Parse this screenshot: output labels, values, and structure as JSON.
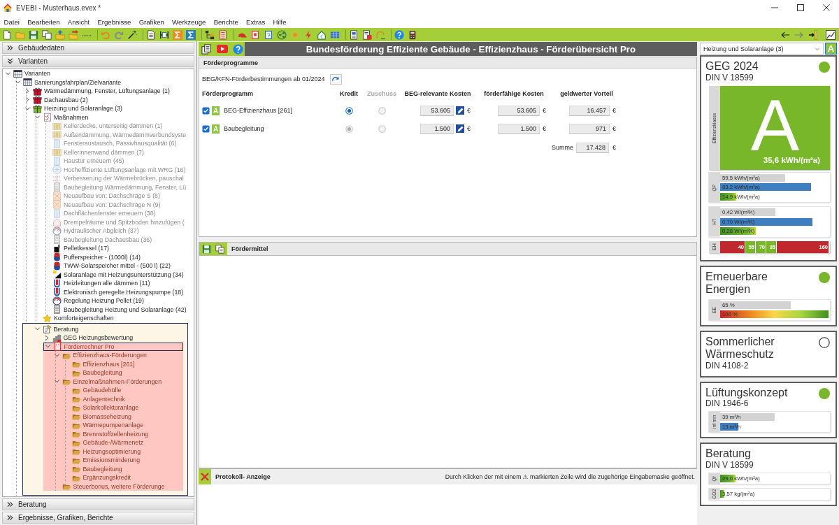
{
  "window": {
    "title": "EVEBI - Musterhaus.evex *"
  },
  "menu": [
    "Datei",
    "Bearbeiten",
    "Ansicht",
    "Ergebnisse",
    "Grafiken",
    "Werkzeuge",
    "Berichte",
    "Extras",
    "Hilfe"
  ],
  "sidebar": {
    "sections": [
      {
        "label": "Gebäudedaten",
        "expanded": false
      },
      {
        "label": "Varianten",
        "expanded": true,
        "tree": [
          {
            "label": "Varianten",
            "kind": "table",
            "expanded": true,
            "selected": false,
            "children": [
              {
                "label": "Sanierungsfahrplan/Zielvariante",
                "kind": "table",
                "expanded": true,
                "selected": false,
                "children": [
                  {
                    "label": "Wärmedämmung, Fenster, Lüftungsanlage (1)",
                    "kind": "variant",
                    "color": "#c8102e",
                    "expanded": false,
                    "selected": false
                  },
                  {
                    "label": "Dachausbau (2)",
                    "kind": "variant",
                    "color": "#c8102e",
                    "expanded": false,
                    "selected": false
                  },
                  {
                    "label": "Heizung und Solaranlage (3)",
                    "kind": "variant",
                    "color": "#7ab829",
                    "expanded": true,
                    "selected": false,
                    "children": [
                      {
                        "label": "Maßnahmen",
                        "kind": "checklist",
                        "expanded": true,
                        "selected": false,
                        "children": [
                          {
                            "label": "Kellerdecke, unterseitig dämmen (1)",
                            "kind": "insulation",
                            "disabled": true,
                            "selected": false
                          },
                          {
                            "label": "Außendämmung, Wärmedämmverbundsyste",
                            "kind": "insulation",
                            "disabled": true,
                            "selected": false
                          },
                          {
                            "label": "Fensteraustausch, Passivhausqualität (6)",
                            "kind": "pane",
                            "disabled": true,
                            "selected": false
                          },
                          {
                            "label": "Kellerinnenwand dämmen (7)",
                            "kind": "insulation",
                            "disabled": true,
                            "selected": false
                          },
                          {
                            "label": "Haustür erneuern (45)",
                            "kind": "pane",
                            "disabled": true,
                            "selected": false
                          },
                          {
                            "label": "Hocheffiziente Lüftungsanlage mit WRG (16)",
                            "kind": "fan",
                            "disabled": true,
                            "selected": false
                          },
                          {
                            "label": "Verbesserung der Wärmebrücken, pauschal",
                            "kind": "bridge",
                            "disabled": true,
                            "selected": false
                          },
                          {
                            "label": "Baubegleitung Wärmedämmung, Fenster, Lü",
                            "kind": "document",
                            "disabled": true,
                            "selected": false
                          },
                          {
                            "label": "Neuaufbau von: Dachschräge S (8)",
                            "kind": "roof",
                            "disabled": true,
                            "selected": false
                          },
                          {
                            "label": "Neuaufbau von: Dachschräge N (9)",
                            "kind": "roof",
                            "disabled": true,
                            "selected": false
                          },
                          {
                            "label": "Dachflächenfenster erneuern (38)",
                            "kind": "pane",
                            "disabled": true,
                            "selected": false
                          },
                          {
                            "label": "Drempelräume und Spitzboden hinzufügen (",
                            "kind": "house",
                            "disabled": true,
                            "selected": false
                          },
                          {
                            "label": "Hydraulischer Abgleich (37)",
                            "kind": "gauge",
                            "disabled": true,
                            "selected": false
                          },
                          {
                            "label": "Baubegleitung Dachausbau (36)",
                            "kind": "document",
                            "disabled": true,
                            "selected": false
                          },
                          {
                            "label": "Pelletkessel (17)",
                            "kind": "boiler",
                            "disabled": false,
                            "selected": false
                          },
                          {
                            "label": "Pufferspeicher - (1000l) (14)",
                            "kind": "tank",
                            "disabled": false,
                            "selected": false
                          },
                          {
                            "label": "TWW-Solarspeicher mittel - (500 l) (22)",
                            "kind": "tank",
                            "disabled": false,
                            "selected": false
                          },
                          {
                            "label": "Solaranlage mit Heizungsunterstützung (34)",
                            "kind": "solar",
                            "disabled": false,
                            "selected": false
                          },
                          {
                            "label": "Heizleitungen alle dämmen (11)",
                            "kind": "pipe",
                            "disabled": false,
                            "selected": false
                          },
                          {
                            "label": "Elektronisch geregelte Heizungspumpe (18)",
                            "kind": "pipe",
                            "disabled": false,
                            "selected": false
                          },
                          {
                            "label": "Regelung Heizung Pellet (19)",
                            "kind": "gauge",
                            "disabled": false,
                            "selected": false
                          },
                          {
                            "label": "Baubegleitung Heizung und Solaranlage (42)",
                            "kind": "document",
                            "disabled": false,
                            "selected": false
                          }
                        ]
                      },
                      {
                        "label": "Komforteigenschaften",
                        "kind": "star",
                        "selected": false
                      },
                      {
                        "label": "Beratung",
                        "kind": "consulting",
                        "expanded": true,
                        "selected": false,
                        "children": [
                          {
                            "label": "GEG Heizungsbewertung",
                            "kind": "assessment",
                            "expanded": false,
                            "selected": false
                          },
                          {
                            "label": "Förderrechner Pro",
                            "kind": "calculator",
                            "expanded": true,
                            "selected": true,
                            "children": [
                              {
                                "label": "Effizienzhaus-Förderungen",
                                "kind": "folder",
                                "expanded": true,
                                "selected": false,
                                "children": [
                                  {
                                    "label": "Effizienzhaus [261]",
                                    "kind": "folder",
                                    "selected": false
                                  },
                                  {
                                    "label": "Baubegleitung",
                                    "kind": "folder",
                                    "selected": false
                                  }
                                ]
                              },
                              {
                                "label": "Einzelmaßnahmen-Förderungen",
                                "kind": "folder",
                                "expanded": true,
                                "selected": false,
                                "children": [
                                  {
                                    "label": "Gebäudehülle",
                                    "kind": "folder",
                                    "selected": false
                                  },
                                  {
                                    "label": "Anlagentechnik",
                                    "kind": "folder",
                                    "selected": false
                                  },
                                  {
                                    "label": "Solarkollektoranlage",
                                    "kind": "folder",
                                    "selected": false
                                  },
                                  {
                                    "label": "Biomasseheizung",
                                    "kind": "folder",
                                    "selected": false
                                  },
                                  {
                                    "label": "Wärmepumpenanlage",
                                    "kind": "folder",
                                    "selected": false
                                  },
                                  {
                                    "label": "Brennstoffzellenheizung",
                                    "kind": "folder",
                                    "selected": false
                                  },
                                  {
                                    "label": "Gebäude-/Wärmenetz",
                                    "kind": "folder",
                                    "selected": false
                                  },
                                  {
                                    "label": "Heizungsoptimierung",
                                    "kind": "folder",
                                    "selected": false
                                  },
                                  {
                                    "label": "Emissionsminderung",
                                    "kind": "folder",
                                    "selected": false
                                  },
                                  {
                                    "label": "Baubegleitung",
                                    "kind": "folder",
                                    "selected": false
                                  },
                                  {
                                    "label": "Ergänzungskredit",
                                    "kind": "folder",
                                    "selected": false
                                  }
                                ]
                              },
                              {
                                "label": "Steuerbonus, weitere Förderunge",
                                "kind": "folder",
                                "selected": false
                              }
                            ]
                          }
                        ]
                      }
                    ]
                  }
                ]
              }
            ]
          }
        ]
      },
      {
        "label": "Beratung",
        "expanded": false
      },
      {
        "label": "Ergebnisse, Grafiken, Berichte",
        "expanded": false
      }
    ]
  },
  "main": {
    "title": "Bundesförderung Effiziente Gebäude - Effizienzhaus - Förderübersicht Pro",
    "programs": {
      "title": "Förderprogramme",
      "rules": "BEG/KFN-Förderbestimmungen ab 01/2024",
      "columns": [
        {
          "label": "Förderprogramm",
          "disabled": false
        },
        {
          "label": "Kredit",
          "disabled": false
        },
        {
          "label": "Zuschuss",
          "disabled": true
        },
        {
          "label": "BEG-relevante Kosten",
          "disabled": false
        },
        {
          "label": "förderfähige Kosten",
          "disabled": false
        },
        {
          "label": "geldwerter Vorteil",
          "disabled": false
        }
      ],
      "rows": [
        {
          "checked": true,
          "badge": "A",
          "name": "BEG-Effizienzhaus [261]",
          "kredit": {
            "selected": true,
            "disabled": false
          },
          "zuschuss": {
            "selected": false,
            "disabled": true
          },
          "beg_costs": {
            "value": "53.605",
            "unit": "€",
            "editable": true
          },
          "eligible_costs": {
            "value": "53.605",
            "unit": "€"
          },
          "benefit": {
            "value": "16.457",
            "unit": "€"
          }
        },
        {
          "checked": true,
          "badge": "A",
          "name": "Baubegleitung",
          "kredit": {
            "selected": true,
            "disabled": true
          },
          "zuschuss": {
            "selected": false,
            "disabled": true
          },
          "beg_costs": {
            "value": "1.500",
            "unit": "€",
            "editable": true
          },
          "eligible_costs": {
            "value": "1.500",
            "unit": "€"
          },
          "benefit": {
            "value": "971",
            "unit": "€"
          }
        }
      ],
      "sum": {
        "label": "Summe",
        "value": "17.428",
        "unit": "€"
      }
    },
    "funding": {
      "title": "Fördermittel"
    },
    "log": {
      "title": "Protokoll- Anzeige",
      "hint": "Durch Klicken der mit einem ⚠ markierten Zeile wird die zugehörige Eingabemaske geöffnet."
    }
  },
  "right_panel": {
    "variant_select": "Heizung und Solaranlage (3)",
    "class_button": "A",
    "cards": [
      {
        "title": "GEG 2024",
        "subtitle": "DIN V 18599",
        "fulfilled": true,
        "blocks": [
          {
            "kind": "class",
            "label": "Effizienzklasse",
            "grade": "A",
            "value": "35,6 kWh/(m²a)"
          },
          {
            "kind": "bars",
            "label": "QP",
            "bars": [
              {
                "kind": "reference",
                "reading": "59,5 kWh/(m²a)",
                "level": 0.6
              },
              {
                "kind": "requirement",
                "reading": "83,2 kWh/(m²a)",
                "level": 0.84
              },
              {
                "kind": "actual",
                "reading": "14,9 kWh/(m²a)",
                "level": 0.15
              }
            ]
          },
          {
            "kind": "bars",
            "label": "HT",
            "bars": [
              {
                "kind": "reference",
                "reading": "0,42 W/(m²K)",
                "level": 0.51
              },
              {
                "kind": "requirement",
                "reading": "0,70 W/(m²K)",
                "level": 0.85
              },
              {
                "kind": "actual",
                "reading": "0,28 W/(m²K)",
                "level": 0.33
              }
            ]
          },
          {
            "kind": "scale",
            "label": "EH",
            "segments": [
              {
                "label": "40",
                "color": "#c0282d"
              },
              {
                "label": "55",
                "color": "#78b72a"
              },
              {
                "label": "70",
                "color": "#78b72a"
              },
              {
                "label": "85",
                "color": "#78b72a"
              },
              {
                "label": "160",
                "color": "#c0282d"
              }
            ]
          }
        ]
      },
      {
        "title": "Erneuerbare Energien",
        "fulfilled": true,
        "blocks": [
          {
            "kind": "bars",
            "label": "EE",
            "bars": [
              {
                "kind": "reference",
                "reading": "65 %",
                "level": 0.65
              },
              {
                "kind": "spectrum",
                "reading": "100 %",
                "level": 1
              }
            ]
          }
        ]
      },
      {
        "title": "Sommerlicher Wärmeschutz",
        "subtitle": "DIN 4108-2",
        "fulfilled": false
      },
      {
        "title": "Lüftungskonzept",
        "subtitle": "DIN 1946-6",
        "fulfilled": true,
        "blocks": [
          {
            "kind": "bars",
            "label": "inf min",
            "bars": [
              {
                "kind": "reference",
                "reading": "39 m³/h",
                "level": 0.5
              },
              {
                "kind": "requirement",
                "reading": "13 m³/h",
                "level": 0.17
              }
            ]
          }
        ]
      },
      {
        "title": "Beratung",
        "subtitle": "DIN V 18599",
        "blocks": [
          {
            "kind": "bars",
            "label": "Qf",
            "bars": [
              {
                "kind": "actual",
                "reading": "29,0 kWh/(m²a)",
                "level": 0.14
              }
            ]
          },
          {
            "kind": "bars",
            "label": "CO2",
            "bars": [
              {
                "kind": "actual",
                "reading": "3,57 kg/(m²a)",
                "level": 0.04
              }
            ]
          }
        ]
      }
    ]
  }
}
